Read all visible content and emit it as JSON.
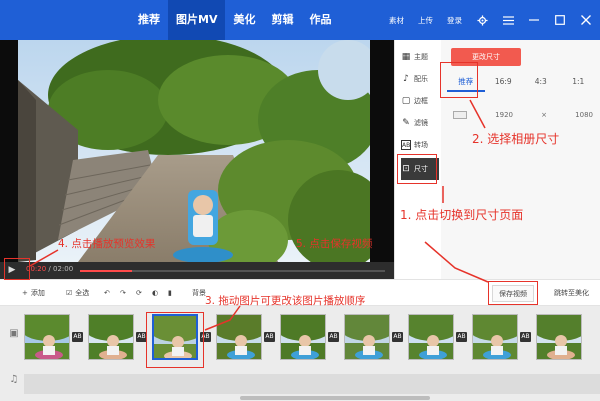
{
  "nav": {
    "items": [
      "推荐",
      "图片MV",
      "美化",
      "剪辑",
      "作品"
    ],
    "active_index": 1
  },
  "top_right": {
    "material": "素材",
    "upload": "上传",
    "login": "登录"
  },
  "playbar": {
    "current_time": "00:20",
    "total_time": "02:00",
    "progress_fraction": 0.17
  },
  "side_menu": {
    "items": [
      {
        "label": "主题",
        "icon": "theme-icon"
      },
      {
        "label": "配乐",
        "icon": "music-icon"
      },
      {
        "label": "边框",
        "icon": "border-icon"
      },
      {
        "label": "滤镜",
        "icon": "filter-icon"
      },
      {
        "label": "转场",
        "icon": "transition-icon"
      },
      {
        "label": "尺寸",
        "icon": "size-icon"
      }
    ],
    "active_index": 5
  },
  "size_panel": {
    "change_size_button": "更改尺寸",
    "ratios": [
      "推荐",
      "16:9",
      "4:3",
      "1:1"
    ],
    "active_ratio_index": 0,
    "width": "1920",
    "times": "×",
    "height": "1080"
  },
  "toolbar": {
    "add": "添加",
    "select_all": "全选",
    "background": "背景",
    "save_video": "保存视频",
    "jump_to_beautify": "跳转至美化"
  },
  "filmstrip": {
    "thumb_count": 9,
    "selected_index": 2,
    "transition_label": "AB"
  },
  "annotations": {
    "step1": "1. 点击切换到尺寸页面",
    "step2": "2. 选择相册尺寸",
    "step3": "3. 拖动图片可更改该图片播放顺序",
    "step4": "4. 点击播放预览效果",
    "step5": "5. 点击保存视频"
  },
  "colors": {
    "brand_blue": "#1f5fd6",
    "annotation_red": "#e6332a",
    "accent_red": "#f25a4f"
  }
}
